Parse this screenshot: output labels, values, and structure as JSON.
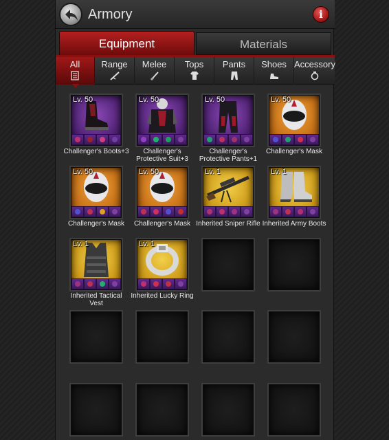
{
  "header": {
    "title": "Armory"
  },
  "tabs": {
    "equipment": "Equipment",
    "materials": "Materials"
  },
  "categories": [
    {
      "label": "All"
    },
    {
      "label": "Range"
    },
    {
      "label": "Melee"
    },
    {
      "label": "Tops"
    },
    {
      "label": "Pants"
    },
    {
      "label": "Shoes"
    },
    {
      "label": "Accessory"
    }
  ],
  "items": [
    {
      "level": "Lv. 50",
      "name": "Challenger's Boots+3",
      "rarity_color": "#7a3aa6"
    },
    {
      "level": "Lv. 50",
      "name": "Challenger's Protective Suit+3",
      "rarity_color": "#7a3aa6"
    },
    {
      "level": "Lv. 50",
      "name": "Challenger's Protective Pants+1",
      "rarity_color": "#7a3aa6"
    },
    {
      "level": "Lv. 50",
      "name": "Challenger's Mask",
      "rarity_color": "#d57f1c"
    },
    {
      "level": "Lv. 50",
      "name": "Challenger's Mask",
      "rarity_color": "#d57f1c"
    },
    {
      "level": "Lv. 50",
      "name": "Challenger's Mask",
      "rarity_color": "#d57f1c"
    },
    {
      "level": "Lv. 1",
      "name": "Inherited Sniper Rifle",
      "rarity_color": "#e0b020"
    },
    {
      "level": "Lv. 1",
      "name": "Inherited Army Boots",
      "rarity_color": "#e0b020"
    },
    {
      "level": "Lv. 1",
      "name": "Inherited Tactical Vest",
      "rarity_color": "#e0b020"
    },
    {
      "level": "Lv. 1",
      "name": "Inherited Lucky Ring",
      "rarity_color": "#e0b020"
    }
  ],
  "colors": {
    "active_tab": "#a01818",
    "accent_red": "#8a1010"
  }
}
